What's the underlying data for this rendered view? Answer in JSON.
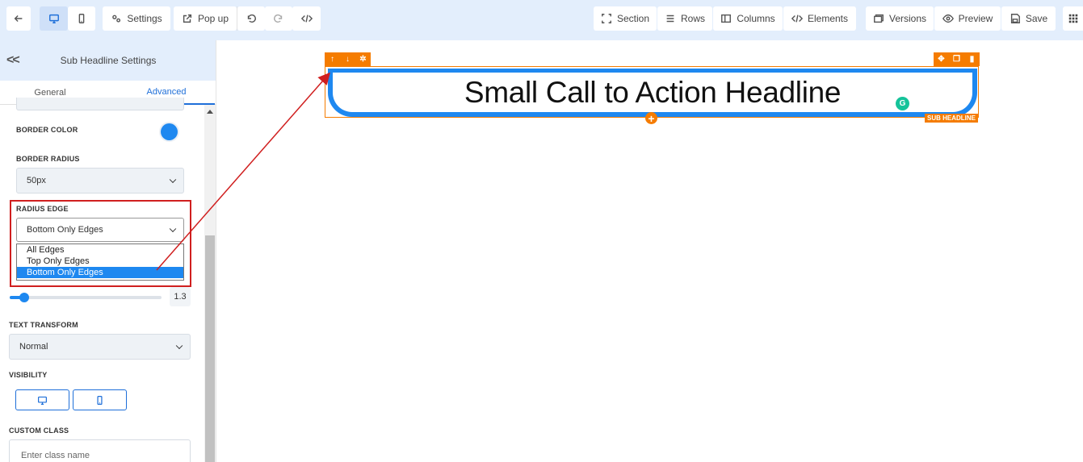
{
  "toolbar": {
    "settings_label": "Settings",
    "popup_label": "Pop up",
    "section_label": "Section",
    "rows_label": "Rows",
    "columns_label": "Columns",
    "elements_label": "Elements",
    "versions_label": "Versions",
    "preview_label": "Preview",
    "save_label": "Save"
  },
  "sidebar": {
    "title": "Sub Headline Settings",
    "tabs": [
      {
        "label": "General",
        "active": false
      },
      {
        "label": "Advanced",
        "active": true
      }
    ],
    "border_color_label": "BORDER COLOR",
    "border_color_value": "#1e88f0",
    "border_radius_label": "BORDER RADIUS",
    "border_radius_value": "50px",
    "radius_edge_label": "RADIUS EDGE",
    "radius_edge_value": "Bottom Only Edges",
    "radius_edge_options": [
      "All Edges",
      "Top Only Edges",
      "Bottom Only Edges"
    ],
    "line_height_value": "1.3",
    "line_height_fraction": 0.1,
    "text_transform_label": "TEXT TRANSFORM",
    "text_transform_value": "Normal",
    "visibility_label": "VISIBILITY",
    "custom_class_label": "CUSTOM CLASS",
    "custom_class_placeholder": "Enter class name"
  },
  "canvas": {
    "headline": "Small Call to Action Headline",
    "element_tag": "SUB HEADLINE"
  },
  "colors": {
    "accent": "#1e88f0",
    "element_toolbar": "#f57c00",
    "annotation": "#d01f1f"
  }
}
